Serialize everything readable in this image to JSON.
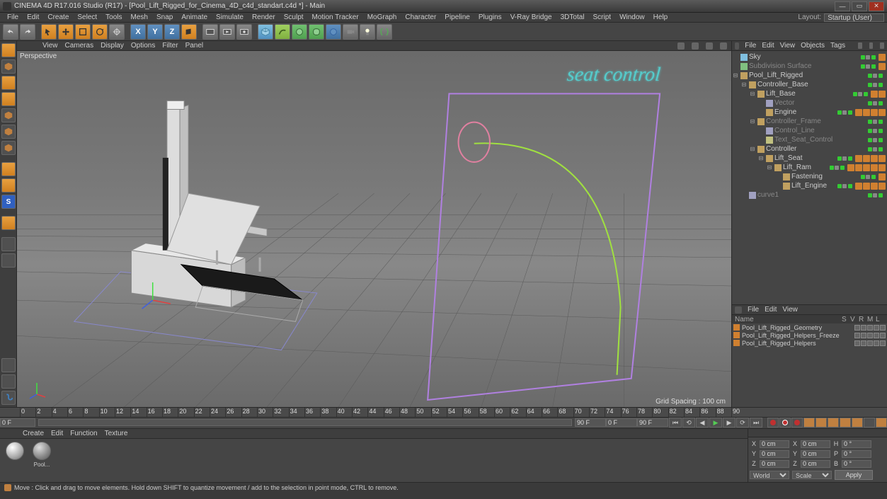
{
  "titlebar": {
    "title": "CINEMA 4D R17.016 Studio (R17) - [Pool_Lift_Rigged_for_Cinema_4D_c4d_standart.c4d *] - Main"
  },
  "menubar": {
    "items": [
      "File",
      "Edit",
      "Create",
      "Select",
      "Tools",
      "Mesh",
      "Snap",
      "Animate",
      "Simulate",
      "Render",
      "Sculpt",
      "Motion Tracker",
      "MoGraph",
      "Character",
      "Pipeline",
      "Plugins",
      "V-Ray Bridge",
      "3DTotal",
      "Script",
      "Window",
      "Help"
    ],
    "layout_label": "Layout:",
    "layout_value": "Startup (User)"
  },
  "viewport_menu": {
    "items": [
      "View",
      "Cameras",
      "Display",
      "Options",
      "Filter",
      "Panel"
    ]
  },
  "viewport": {
    "label": "Perspective",
    "overlay_text": "seat control",
    "grid_info": "Grid Spacing : 100 cm"
  },
  "object_panel": {
    "menu": [
      "File",
      "Edit",
      "View",
      "Objects",
      "Tags"
    ],
    "tree": [
      {
        "depth": 0,
        "expand": "",
        "icon": "sky",
        "label": "Sky",
        "dim": false,
        "dots": 2,
        "tags": 1
      },
      {
        "depth": 0,
        "expand": "",
        "icon": "sds",
        "label": "Subdivision Surface",
        "dim": true,
        "dots": 2,
        "tags": 1
      },
      {
        "depth": 0,
        "expand": "-",
        "icon": "null",
        "label": "Pool_Lift_Rigged",
        "dim": false,
        "dots": 2,
        "tags": 0
      },
      {
        "depth": 1,
        "expand": "-",
        "icon": "null",
        "label": "Controller_Base",
        "dim": false,
        "dots": 2,
        "tags": 0
      },
      {
        "depth": 2,
        "expand": "-",
        "icon": "null",
        "label": "Lift_Base",
        "dim": false,
        "dots": 2,
        "tags": 2
      },
      {
        "depth": 3,
        "expand": "",
        "icon": "spline",
        "label": "Vector",
        "dim": true,
        "dots": 2,
        "tags": 0
      },
      {
        "depth": 3,
        "expand": "",
        "icon": "null",
        "label": "Engine",
        "dim": false,
        "dots": 2,
        "tags": 4
      },
      {
        "depth": 2,
        "expand": "-",
        "icon": "null",
        "label": "Controller_Frame",
        "dim": true,
        "dots": 2,
        "tags": 0
      },
      {
        "depth": 3,
        "expand": "",
        "icon": "spline",
        "label": "Control_Line",
        "dim": true,
        "dots": 2,
        "tags": 0
      },
      {
        "depth": 3,
        "expand": "",
        "icon": "text",
        "label": "Text_Seat_Control",
        "dim": true,
        "dots": 2,
        "tags": 0
      },
      {
        "depth": 2,
        "expand": "-",
        "icon": "null",
        "label": "Controller",
        "dim": false,
        "dots": 2,
        "tags": 0
      },
      {
        "depth": 3,
        "expand": "-",
        "icon": "null",
        "label": "Lift_Seat",
        "dim": false,
        "dots": 2,
        "tags": 4
      },
      {
        "depth": 4,
        "expand": "-",
        "icon": "null",
        "label": "Lift_Ram",
        "dim": false,
        "dots": 2,
        "tags": 5
      },
      {
        "depth": 5,
        "expand": "",
        "icon": "null",
        "label": "Fastening",
        "dim": false,
        "dots": 2,
        "tags": 1
      },
      {
        "depth": 5,
        "expand": "",
        "icon": "null",
        "label": "Lift_Engine",
        "dim": false,
        "dots": 2,
        "tags": 4
      },
      {
        "depth": 1,
        "expand": "",
        "icon": "spline",
        "label": "curve1",
        "dim": true,
        "dots": 2,
        "tags": 0
      }
    ]
  },
  "attr_panel": {
    "menu": [
      "File",
      "Edit",
      "View"
    ],
    "header": {
      "name": "Name",
      "s": "S",
      "v": "V",
      "r": "R",
      "m": "M",
      "l": "L"
    },
    "rows": [
      {
        "label": "Pool_Lift_Rigged_Geometry"
      },
      {
        "label": "Pool_Lift_Rigged_Helpers_Freeze"
      },
      {
        "label": "Pool_Lift_Rigged_Helpers"
      }
    ]
  },
  "timeline": {
    "start": "0 F",
    "end": "90 F",
    "current": "0 F",
    "range_end": "90 F",
    "ticks": [
      0,
      2,
      4,
      6,
      8,
      10,
      12,
      14,
      16,
      18,
      20,
      22,
      24,
      26,
      28,
      30,
      32,
      34,
      36,
      38,
      40,
      42,
      44,
      46,
      48,
      50,
      52,
      54,
      56,
      58,
      60,
      62,
      64,
      66,
      68,
      70,
      72,
      74,
      76,
      78,
      80,
      82,
      84,
      86,
      88,
      90
    ]
  },
  "material_menu": {
    "items": [
      "Create",
      "Edit",
      "Function",
      "Texture"
    ]
  },
  "materials": [
    {
      "name": "",
      "type": "maxon"
    },
    {
      "name": "Pool...",
      "type": "std"
    }
  ],
  "coords": {
    "header": [
      "",
      "",
      "",
      ""
    ],
    "x": {
      "pos": "0 cm",
      "size": "0 cm",
      "rot_h": "0 °"
    },
    "y": {
      "pos": "0 cm",
      "size": "0 cm",
      "rot_p": "0 °"
    },
    "z": {
      "pos": "0 cm",
      "size": "0 cm",
      "rot_b": "0 °"
    },
    "mode1": "World",
    "mode2": "Scale",
    "apply": "Apply"
  },
  "statusbar": {
    "text": "Move : Click and drag to move elements. Hold down SHIFT to quantize movement / add to the selection in point mode, CTRL to remove."
  }
}
